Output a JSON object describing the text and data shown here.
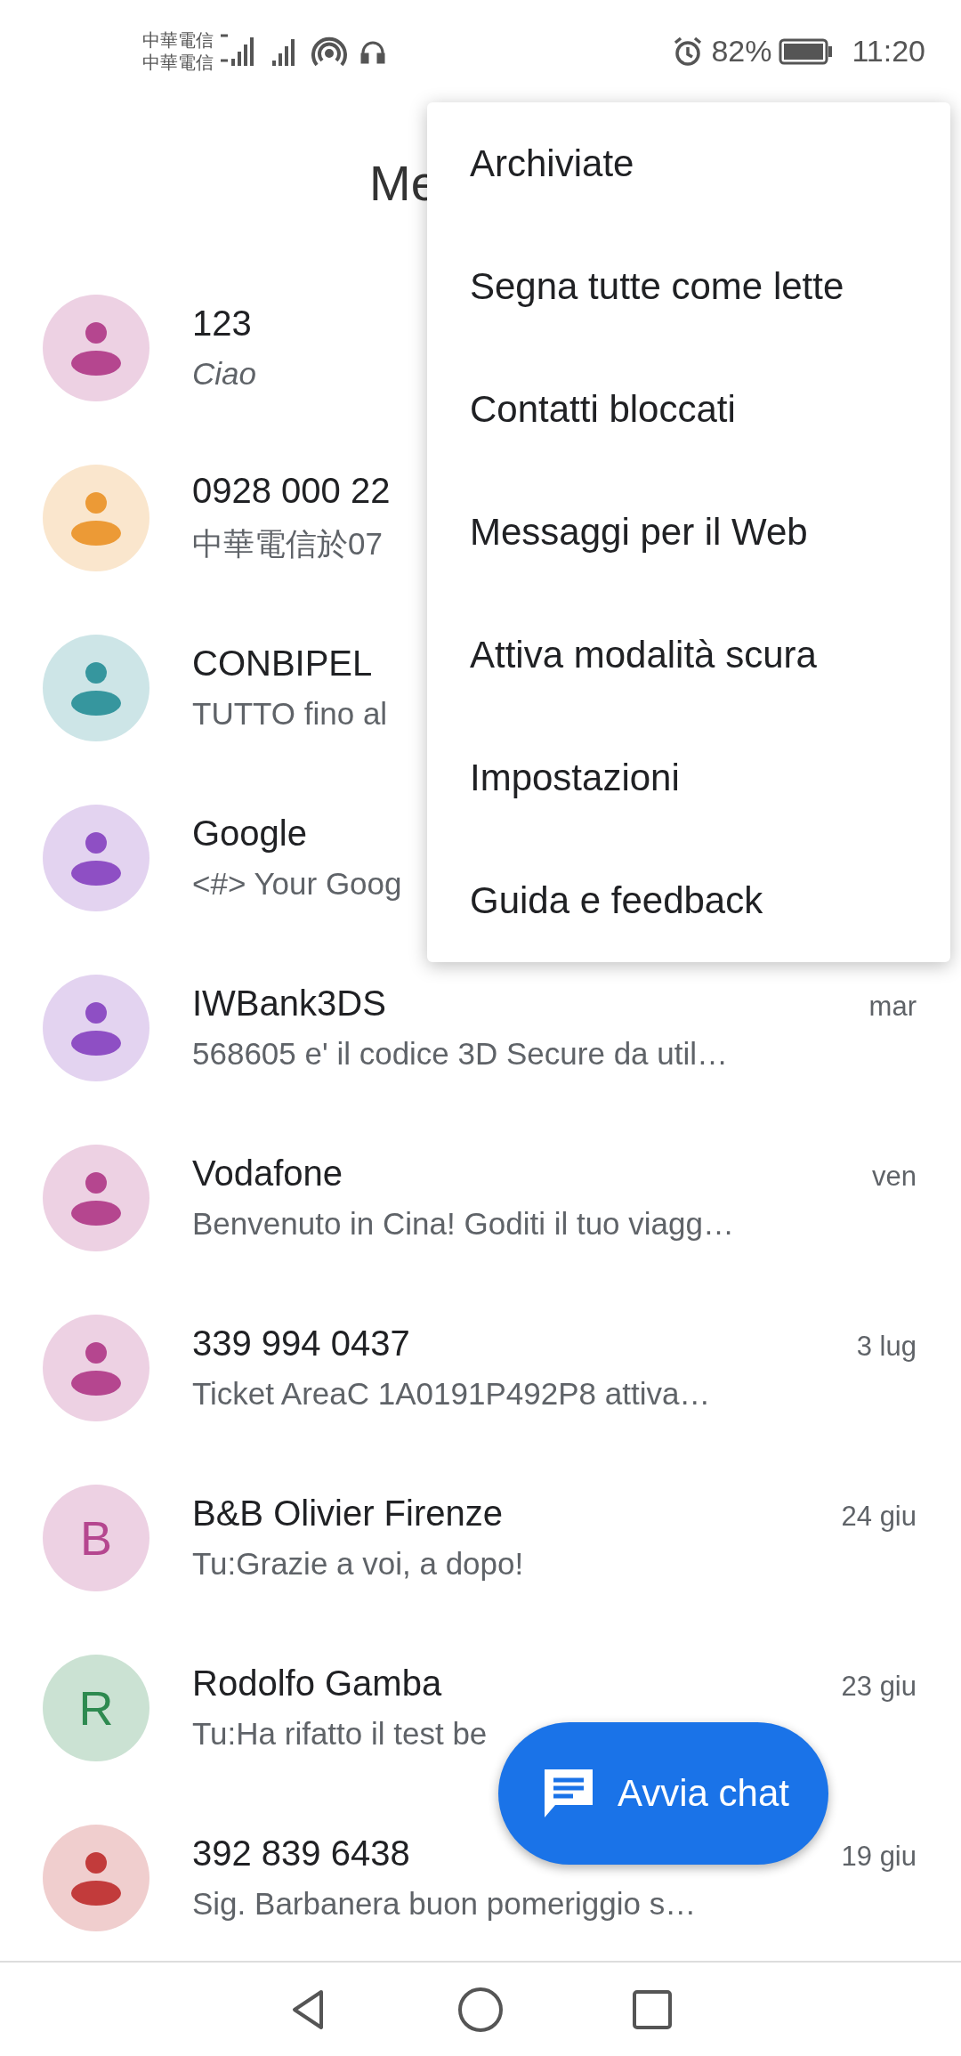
{
  "status_bar": {
    "carriers": [
      "中華電信",
      "中華電信"
    ],
    "battery_percent": "82%",
    "time": "11:20"
  },
  "header": {
    "title": "Me"
  },
  "conversations": [
    {
      "name": "123",
      "snippet": "Ciao",
      "draft": true,
      "avatar": {
        "kind": "person",
        "color": "#b5468f"
      }
    },
    {
      "name": "0928 000 22",
      "snippet": "中華電信於07",
      "draft": false,
      "avatar": {
        "kind": "person",
        "color": "#ec9a36"
      }
    },
    {
      "name": "CONBIPEL",
      "snippet": "TUTTO fino al",
      "draft": false,
      "avatar": {
        "kind": "person",
        "color": "#36969e"
      }
    },
    {
      "name": "Google",
      "snippet": "<#> Your Goog",
      "draft": false,
      "avatar": {
        "kind": "person",
        "color": "#8e4fc4"
      }
    },
    {
      "name": "IWBank3DS",
      "snippet": "568605 e' il codice 3D Secure da util…",
      "draft": false,
      "date": "mar",
      "avatar": {
        "kind": "person",
        "color": "#8e4fc4"
      }
    },
    {
      "name": "Vodafone",
      "snippet": "Benvenuto in Cina! Goditi il tuo viagg…",
      "draft": false,
      "date": "ven",
      "avatar": {
        "kind": "person",
        "color": "#b5468f"
      }
    },
    {
      "name": "339 994 0437",
      "snippet": "Ticket AreaC 1A0191P492P8 attiva…",
      "draft": false,
      "date": "3 lug",
      "avatar": {
        "kind": "person",
        "color": "#b5468f"
      }
    },
    {
      "name": "B&B Olivier Firenze",
      "snippet": "Tu:Grazie a voi, a dopo!",
      "draft": false,
      "date": "24 giu",
      "avatar": {
        "kind": "letter",
        "letter": "B",
        "color": "#b5468f"
      }
    },
    {
      "name": "Rodolfo Gamba",
      "snippet": "Tu:Ha rifatto il test be",
      "draft": false,
      "date": "23 giu",
      "avatar": {
        "kind": "letter",
        "letter": "R",
        "color": "#2e8a50"
      }
    },
    {
      "name": "392 839 6438",
      "snippet": "Sig. Barbanera buon pomeriggio s…",
      "draft": false,
      "date": "19 giu",
      "avatar": {
        "kind": "person",
        "color": "#c23b3b"
      }
    }
  ],
  "menu": {
    "items": [
      "Archiviate",
      "Segna tutte come lette",
      "Contatti bloccati",
      "Messaggi per il Web",
      "Attiva modalità scura",
      "Impostazioni",
      "Guida e feedback"
    ]
  },
  "fab": {
    "label": "Avvia chat"
  }
}
